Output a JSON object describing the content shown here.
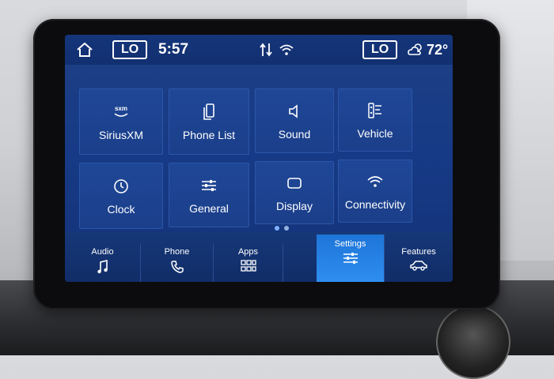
{
  "topbar": {
    "left_lo": "LO",
    "time": "5:57",
    "right_lo": "LO",
    "temperature": "72°",
    "icons": [
      "home-icon",
      "sync-arrows-icon",
      "wifi-icon",
      "weather-cloud-sun-icon"
    ]
  },
  "tiles": [
    {
      "label": "SiriusXM",
      "icon": "siriusxm-icon",
      "badge": "sxm"
    },
    {
      "label": "Phone List",
      "icon": "phone-list-icon"
    },
    {
      "label": "Sound",
      "icon": "speaker-icon"
    },
    {
      "label": "Vehicle",
      "icon": "vehicle-icon"
    },
    {
      "label": "Clock",
      "icon": "clock-icon"
    },
    {
      "label": "General",
      "icon": "sliders-icon"
    },
    {
      "label": "Display",
      "icon": "display-icon"
    },
    {
      "label": "Connectivity",
      "icon": "wifi-icon"
    }
  ],
  "pager": {
    "pages": 2,
    "current": 1
  },
  "tabs": [
    {
      "label": "Audio",
      "icon": "music-note-icon"
    },
    {
      "label": "Phone",
      "icon": "phone-icon"
    },
    {
      "label": "Apps",
      "icon": "apps-grid-icon"
    },
    {
      "label": "Settings",
      "icon": "settings-sliders-icon",
      "active": true
    },
    {
      "label": "Features",
      "icon": "car-icon"
    }
  ],
  "colors": {
    "screen_bg": "#173a86",
    "active_tab": "#2e8ef0",
    "text": "#ffffff"
  }
}
